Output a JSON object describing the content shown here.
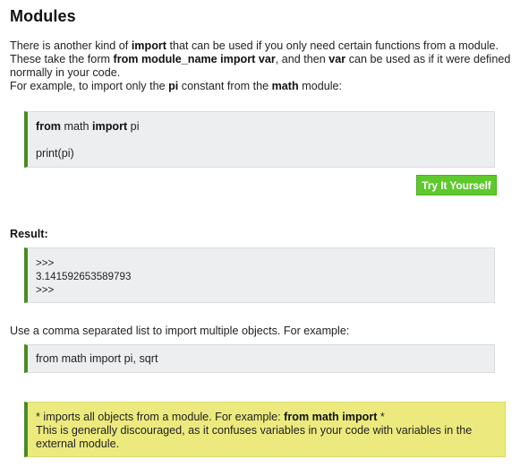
{
  "heading": "Modules",
  "intro": {
    "s1_pre": "There is another kind of ",
    "s1_bold": "import",
    "s1_post": " that can be used if you only need certain functions from a module.",
    "s2_pre": "These take the form ",
    "s2_bold1": "from module_name import var",
    "s2_mid": ", and then ",
    "s2_bold2": "var",
    "s2_post": " can be used as if it were defined normally in your code.",
    "s3_pre": "For example, to import only the ",
    "s3_bold1": "pi",
    "s3_mid": " constant from the ",
    "s3_bold2": "math",
    "s3_post": " module:"
  },
  "code_example": {
    "kw_from": "from",
    "module": " math ",
    "kw_import": "import",
    "name": " pi",
    "line2": "print(pi)"
  },
  "try_button": "Try It Yourself",
  "result_label": "Result:",
  "result_lines": [
    ">>>",
    "3.141592653589793",
    ">>>"
  ],
  "comma_text": "Use a comma separated list to import multiple objects. For example:",
  "code_multi": "from math import pi, sqrt",
  "note": {
    "l1_pre": "* imports all objects from a module. For example: ",
    "l1_bold": "from math import",
    "l1_post": " *",
    "l2": "This is generally discouraged, as it confuses variables in your code with variables in the external module."
  }
}
